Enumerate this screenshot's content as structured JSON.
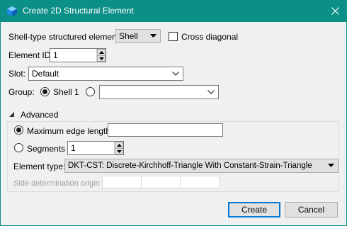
{
  "window": {
    "title": "Create 2D Structural Element",
    "titlebar_color": "#0b8f86",
    "app_icon": "cube-icon",
    "close_icon": "close-icon"
  },
  "form": {
    "shell_type_label": "Shell-type structured element:",
    "shell_type_value": "Shell",
    "cross_diagonal_label": "Cross diagonal",
    "cross_diagonal_checked": false,
    "element_id_label": "Element ID",
    "element_id_value": "1",
    "slot_label": "Slot:",
    "slot_value": "Default",
    "group_label": "Group:",
    "group_option_1": "Shell 1",
    "group_option_1_selected": true,
    "group_option_2_value": ""
  },
  "advanced": {
    "header": "Advanced",
    "expanded": true,
    "max_edge_label": "Maximum edge length",
    "max_edge_value": "",
    "max_edge_selected": true,
    "segments_label": "Segments",
    "segments_value": "1",
    "element_type_label": "Element type:",
    "element_type_value": "DKT-CST: Discrete-Kirchhoff-Triangle With Constant-Strain-Triangle",
    "side_determination_label": "Side determination origin"
  },
  "buttons": {
    "create_label": "Create",
    "cancel_label": "Cancel"
  }
}
